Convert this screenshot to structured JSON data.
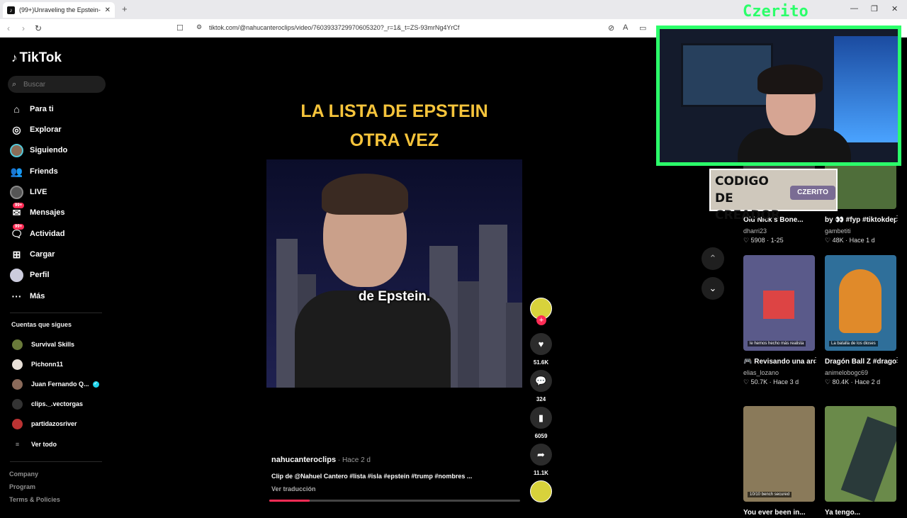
{
  "browser": {
    "tab_title": "(99+)Unraveling the Epstein-",
    "tab_close": "✕",
    "new_tab": "+",
    "url": "tiktok.com/@nahucanteroclips/video/7603933729970605320?_r=1&_t=ZS-93mrNg4YrCf",
    "win_min": "—",
    "win_max": "❐",
    "win_close": "✕"
  },
  "sidebar": {
    "logo": "TikTok",
    "search_placeholder": "Buscar",
    "nav": [
      {
        "label": "Para ti",
        "icon": "home-icon"
      },
      {
        "label": "Explorar",
        "icon": "compass-icon"
      },
      {
        "label": "Siguiendo",
        "icon": "avatar-icon"
      },
      {
        "label": "Friends",
        "icon": "friends-icon"
      },
      {
        "label": "LIVE",
        "icon": "live-icon"
      },
      {
        "label": "Mensajes",
        "icon": "messages-icon",
        "badge": "99+"
      },
      {
        "label": "Actividad",
        "icon": "activity-icon",
        "badge": "99+"
      },
      {
        "label": "Cargar",
        "icon": "upload-icon"
      },
      {
        "label": "Perfil",
        "icon": "profile-icon"
      },
      {
        "label": "Más",
        "icon": "more-icon"
      }
    ],
    "following_title": "Cuentas que sigues",
    "following": [
      {
        "name": "Survival Skills",
        "color": "#6a7a3a"
      },
      {
        "name": "Pichonn11",
        "color": "#e8e0d8"
      },
      {
        "name": "Juan Fernando Q...",
        "color": "#8a6a5a",
        "verified": true
      },
      {
        "name": "clips._.vectorgas",
        "color": "#222"
      },
      {
        "name": "partidazosriver",
        "color": "#b33"
      }
    ],
    "see_all": "Ver todo",
    "footer": [
      "Company",
      "Program",
      "Terms & Policies"
    ]
  },
  "video": {
    "title_line1": "LA LISTA DE EPSTEIN",
    "title_line2": "OTRA VEZ",
    "caption": "de Epstein.",
    "author": "nahucanteroclips",
    "time": " · Hace 2 d",
    "description": "Clip de @Nahuel Cantero #lista #isla #epstein #trump #nombres ...",
    "translate": "Ver traducción",
    "progress": 0.16
  },
  "actions": {
    "likes": "51.6K",
    "comments": "324",
    "saves": "6059",
    "shares": "11.1K"
  },
  "related": [
    {
      "title": "Old Nick's Bone...",
      "author": "dharri23",
      "stats": "♡ 5908 · 1-25",
      "color": "#3b3b3b"
    },
    {
      "title": "by 👀 #fyp #tiktokdeportes...",
      "author": "gambetiti",
      "stats": "♡ 48K · Hace 1 d",
      "color": "#4f6e3a"
    },
    {
      "title": "🎮 Revisando una ardilla en pixel ar...",
      "author": "elias_lozano",
      "stats": "♡ 50.7K · Hace 3 d",
      "color": "#5a5a8a",
      "tag": "le hemos hecho más realista"
    },
    {
      "title": "Dragón Ball Z #dragonball...",
      "author": "animelobogc69",
      "stats": "♡ 80.4K · Hace 2 d",
      "color": "#2f6f9a",
      "tag": "La batalla de los dioses"
    },
    {
      "title": "You ever been in...",
      "author": "",
      "stats": "",
      "color": "#8a7a5a",
      "tag": "10/10 bench secured"
    },
    {
      "title": "Ya tengo...",
      "author": "",
      "stats": "",
      "color": "#6a8a4a"
    }
  ],
  "overlay": {
    "streamer_name": "Czerito",
    "code_title": "CODIGO DE CREADOR",
    "code_value": "CZERITO"
  }
}
